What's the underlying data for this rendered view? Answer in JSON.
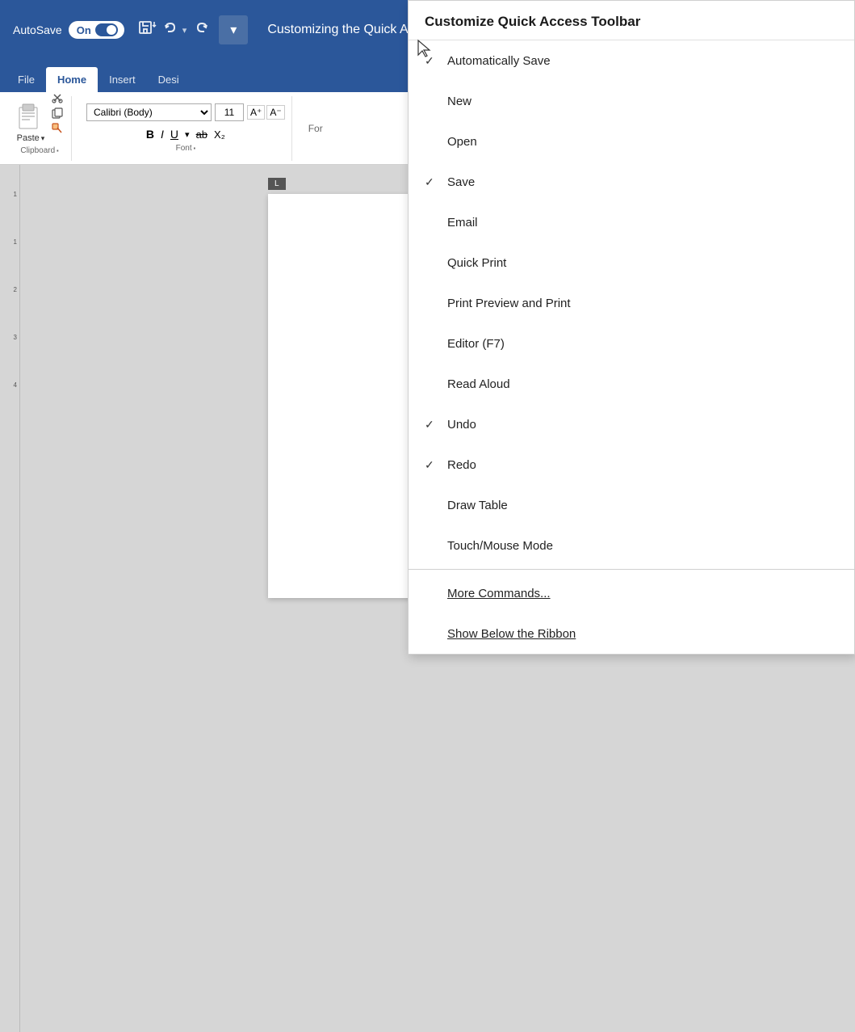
{
  "titlebar": {
    "autosave_label": "AutoSave",
    "toggle_state": "On",
    "title": "Customizing the Quick Acc"
  },
  "ribbon": {
    "tabs": [
      {
        "label": "File",
        "active": false
      },
      {
        "label": "Home",
        "active": true
      },
      {
        "label": "Insert",
        "active": false
      },
      {
        "label": "Desi",
        "active": false
      }
    ],
    "clipboard_group_label": "Clipboard",
    "paste_label": "Paste",
    "font_group": {
      "font_name": "Calibri (Body)",
      "font_size": "11"
    },
    "format_group_label": "For"
  },
  "dropdown": {
    "title": "Customize Quick Access Toolbar",
    "items": [
      {
        "label": "Automatically Save",
        "checked": true
      },
      {
        "label": "New",
        "checked": false
      },
      {
        "label": "Open",
        "checked": false
      },
      {
        "label": "Save",
        "checked": true
      },
      {
        "label": "Email",
        "checked": false
      },
      {
        "label": "Quick Print",
        "checked": false
      },
      {
        "label": "Print Preview and Print",
        "checked": false
      },
      {
        "label": "Editor (F7)",
        "checked": false
      },
      {
        "label": "Read Aloud",
        "checked": false
      },
      {
        "label": "Undo",
        "checked": true
      },
      {
        "label": "Redo",
        "checked": true
      },
      {
        "label": "Draw Table",
        "checked": false
      },
      {
        "label": "Touch/Mouse Mode",
        "checked": false
      }
    ],
    "more_commands": "More Commands...",
    "show_below": "Show Below the Ribbon"
  }
}
